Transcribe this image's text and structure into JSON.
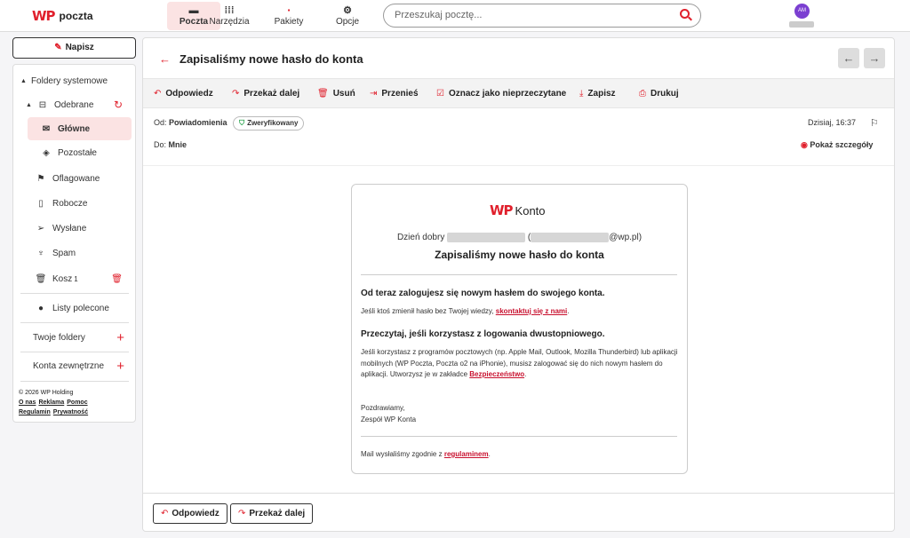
{
  "app": {
    "logo_text": "poczta",
    "logo_mark": "WP"
  },
  "nav": [
    {
      "label": "Poczta",
      "icon": "inbox-icon",
      "active": true
    },
    {
      "label": "Narzędzia",
      "icon": "grid-icon"
    },
    {
      "label": "Pakiety",
      "icon": "package-icon"
    },
    {
      "label": "Opcje",
      "icon": "gear-icon"
    }
  ],
  "search": {
    "placeholder": "Przeszukaj pocztę..."
  },
  "user": {
    "initials": "AM"
  },
  "sidebar": {
    "compose_label": "Napisz",
    "system_folders_label": "Foldery systemowe",
    "inbox_label": "Odebrane",
    "items": [
      {
        "label": "Główne",
        "icon": "envelope-icon",
        "active": true
      },
      {
        "label": "Pozostałe",
        "icon": "layers-icon"
      },
      {
        "label": "Oflagowane",
        "icon": "flag-icon"
      },
      {
        "label": "Robocze",
        "icon": "draft-icon"
      },
      {
        "label": "Wysłane",
        "icon": "send-icon"
      },
      {
        "label": "Spam",
        "icon": "spam-icon"
      },
      {
        "label": "Kosz",
        "badge": "1",
        "icon": "trash-icon"
      }
    ],
    "recommended_label": "Listy polecone",
    "your_folders_label": "Twoje foldery",
    "external_accounts_label": "Konta zewnętrzne",
    "footer": {
      "copyright": "© 2026 WP Holding",
      "links": [
        "O nas",
        "Reklama",
        "Pomoc",
        "Regulamin",
        "Prywatność"
      ]
    }
  },
  "message": {
    "subject": "Zapisaliśmy nowe hasło do konta",
    "actions": [
      {
        "label": "Odpowiedz",
        "icon": "reply-icon"
      },
      {
        "label": "Przekaż dalej",
        "icon": "forward-icon"
      },
      {
        "label": "Usuń",
        "icon": "trash-icon"
      },
      {
        "label": "Przenieś",
        "icon": "move-icon"
      },
      {
        "label": "Oznacz jako nieprzeczytane",
        "icon": "mark-unread-icon"
      },
      {
        "label": "Zapisz",
        "icon": "download-icon"
      },
      {
        "label": "Drukuj",
        "icon": "print-icon"
      }
    ],
    "from_label": "Od:",
    "from_name": "Powiadomienia",
    "verified_label": "Zweryfikowany",
    "to_label": "Do:",
    "to_name": "Mnie",
    "date": "Dzisiaj, 16:37",
    "show_details": "Pokaż szczegóły",
    "body": {
      "logo_text": "Konto",
      "greeting_prefix": "Dzień dobry",
      "greeting_open": "(",
      "greeting_suffix": "@wp.pl)",
      "title": "Zapisaliśmy nowe hasło do konta",
      "h1": "Od teraz zalogujesz się nowym hasłem do swojego konta.",
      "p1_text": "Jeśli ktoś zmienił hasło bez Twojej wiedzy,",
      "p1_link": "skontaktuj się z nami",
      "p1_end": ".",
      "h2": "Przeczytaj, jeśli korzystasz z logowania dwustopniowego.",
      "p2_text": "Jeśli korzystasz z programów pocztowych (np. Apple Mail, Outlook, Mozilla Thunderbird) lub aplikacji mobilnych (WP Poczta, Poczta o2 na iPhonie), musisz zalogować się do nich nowym hasłem do aplikacji. Utworzysz je w zakładce",
      "p2_link": "Bezpieczeństwo",
      "p2_end": ".",
      "sign1": "Pozdrawiamy,",
      "sign2": "Zespół WP Konta",
      "footer_text": "Mail wysłaliśmy zgodnie z",
      "footer_link": "regulaminem",
      "footer_end": "."
    },
    "bottom_actions": [
      {
        "label": "Odpowiedz"
      },
      {
        "label": "Przekaż dalej"
      }
    ]
  }
}
